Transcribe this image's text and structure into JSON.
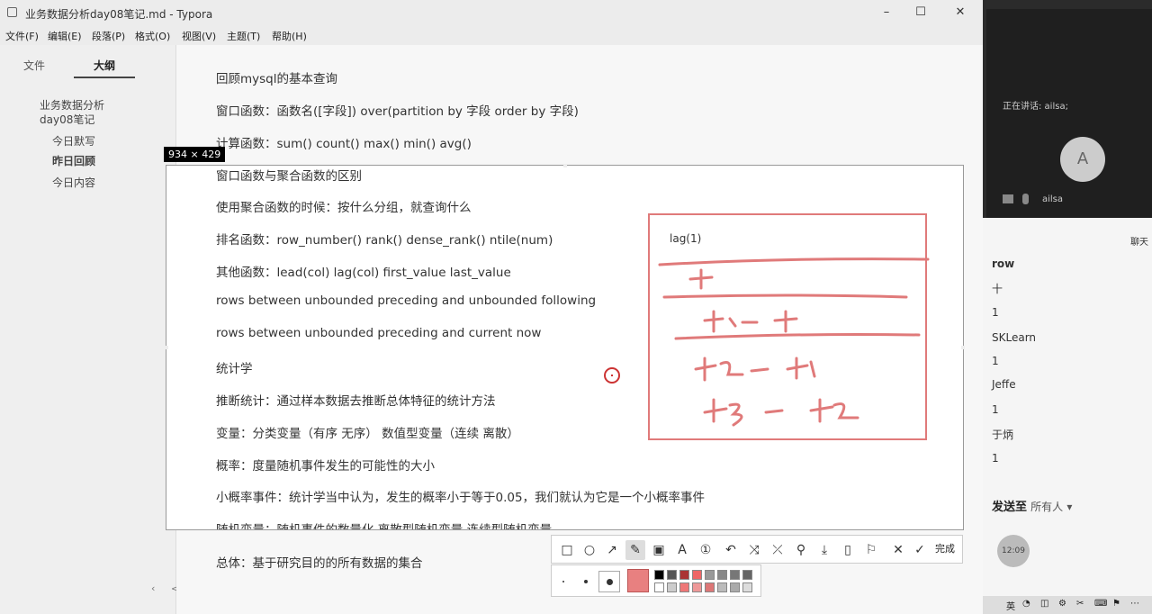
{
  "window": {
    "title": "业务数据分析day08笔记.md - Typora",
    "controls": [
      "minimize-icon",
      "maximize-icon",
      "close-icon"
    ]
  },
  "menu": [
    "文件(F)",
    "编辑(E)",
    "段落(P)",
    "格式(O)",
    "视图(V)",
    "主题(T)",
    "帮助(H)"
  ],
  "sidebar": {
    "tabs": [
      "文件",
      "大纲"
    ],
    "active_tab": "大纲",
    "outline": [
      "业务数据分析",
      "day08笔记",
      "今日默写",
      "昨日回顾",
      "今日内容"
    ]
  },
  "editor": {
    "lines_above": [
      "回顾mysql的基本查询",
      "窗口函数：函数名([字段]) over(partition by 字段 order by 字段)",
      "计算函数：sum() count()  max() min() avg()"
    ],
    "capture_lines": [
      "窗口函数与聚合函数的区别",
      "使用聚合函数的时候：按什么分组，就查询什么",
      "排名函数：row_number()  rank() dense_rank() ntile(num)",
      "其他函数：lead(col)  lag(col)  first_value last_value",
      "rows between unbounded preceding  and unbounded following",
      "rows between unbounded preceding  and current now",
      "统计学",
      "推断统计：通过样本数据去推断总体特征的统计方法",
      "变量：分类变量（有序 无序） 数值型变量（连续 离散）",
      "概率：度量随机事件发生的可能性的大小",
      "小概率事件：统计学当中认为，发生的概率小于等于0.05，我们就认为它是一个小概率事件",
      "随机变量：随机事件的数量化 离散型随机变量 连续型随机变量"
    ],
    "line_below": "总体：基于研究目的的所有数据的集合"
  },
  "capture": {
    "dimensions": "934 × 429",
    "annotation_label": "lag(1)",
    "accent": "#e07a7a"
  },
  "toolbar": {
    "tools": [
      "rectangle-icon",
      "ellipse-icon",
      "arrow-icon",
      "pen-icon",
      "mosaic-icon",
      "text-icon",
      "number-icon",
      "undo-icon",
      "redo-icon",
      "pin-icon",
      "download-icon",
      "save-icon",
      "bookmark-icon",
      "cancel-icon",
      "confirm-icon"
    ],
    "done_label": "完成"
  },
  "right_panel": {
    "speaking": "正在讲话: ailsa;",
    "avatar_initial": "A",
    "participant": "ailsa",
    "chat_header_right": "聊天",
    "chat_lines": [
      "row",
      "十",
      "1",
      "SKLearn",
      "1",
      "Jeffe",
      "1",
      "于炳",
      "1"
    ],
    "send_to_label": "发送至",
    "send_to_target": "所有人",
    "timer": "12:09"
  },
  "taskbar": {
    "ime": "英"
  }
}
